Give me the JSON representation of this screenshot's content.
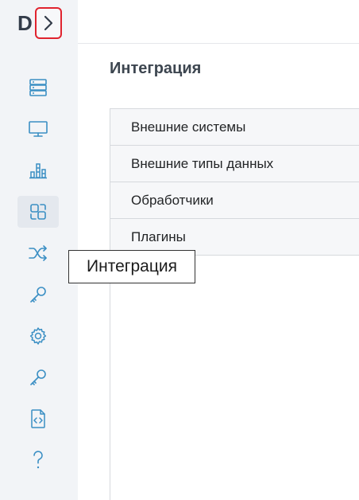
{
  "sidebar": {
    "logo": "D",
    "icons": [
      {
        "name": "database-icon"
      },
      {
        "name": "monitor-icon"
      },
      {
        "name": "bar-chart-icon"
      },
      {
        "name": "integration-icon",
        "active": true
      },
      {
        "name": "shuffle-icon"
      },
      {
        "name": "key-icon"
      },
      {
        "name": "gear-icon"
      },
      {
        "name": "key-icon"
      },
      {
        "name": "code-file-icon"
      },
      {
        "name": "help-icon"
      }
    ],
    "accent_color": "#3b8fc4",
    "highlight_border_color": "#e0232e"
  },
  "page": {
    "title": "Интеграция"
  },
  "menu": {
    "items": [
      {
        "label": "Внешние системы"
      },
      {
        "label": "Внешние типы данных"
      },
      {
        "label": "Обработчики"
      },
      {
        "label": "Плагины"
      }
    ]
  },
  "tooltip": {
    "text": "Интеграция"
  }
}
